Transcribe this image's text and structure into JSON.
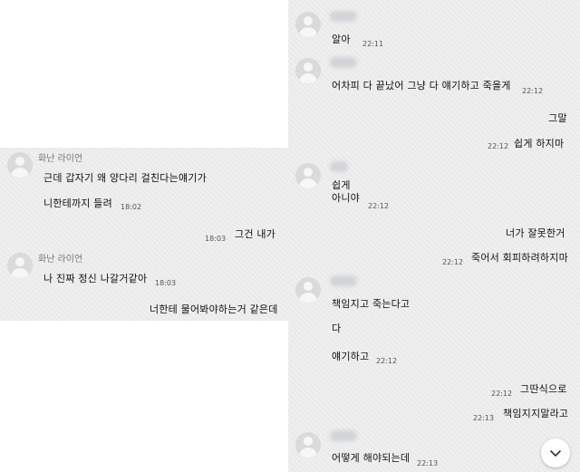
{
  "left_chat": {
    "name1": "화난 라이언",
    "msg1a": "근데 갑자기 왜 양다리 걸친다는얘기가",
    "msg1b": "니한테까지 들려",
    "time1": "18:02",
    "msg2": "그건 내가",
    "time2": "18:03",
    "name2": "화난 라이언",
    "msg3": "나 진짜 정신 나갈거같아",
    "time3": "18:03",
    "msg4": "너한테 물어봐야하는거 같은데"
  },
  "right_chat": {
    "m1": "알아",
    "t1": "22:11",
    "m2": "어차피 다 끝났어 그냥 다 얘기하고 죽을게",
    "t2": "22:12",
    "m3": "그말",
    "m4": "쉽게 하지마",
    "t3": "22:12",
    "m5a": "쉽게",
    "m5b": "아니야",
    "t4": "22:12",
    "m6": "너가 잘못한거",
    "m7": "죽어서 회피하려하지마",
    "t5": "22:12",
    "m8": "책임지고 죽는다고",
    "m9": "다",
    "m10": "얘기하고",
    "t6": "22:12",
    "t7": "22:12",
    "m11": "그딴식으로",
    "t8": "22:13",
    "m12": "책임지지말라고",
    "m13": "어떻게 해야되는데",
    "t9": "22:13"
  },
  "icons": {
    "scroll_down": "chevron-down-icon",
    "avatar": "default-avatar-icon"
  }
}
